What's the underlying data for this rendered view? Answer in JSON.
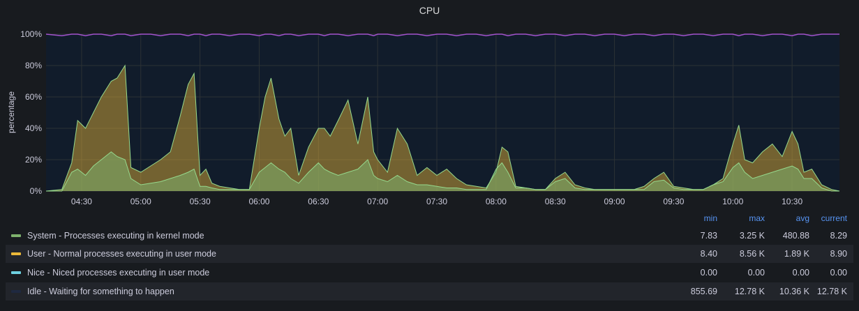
{
  "panel": {
    "title": "CPU"
  },
  "chart_data": {
    "type": "area",
    "title": "CPU",
    "ylabel": "percentage",
    "ylim": [
      0,
      100
    ],
    "y_ticks": [
      "0%",
      "20%",
      "40%",
      "60%",
      "80%",
      "100%"
    ],
    "x_ticks": [
      "04:30",
      "05:00",
      "05:30",
      "06:00",
      "06:30",
      "07:00",
      "07:30",
      "08:00",
      "08:30",
      "09:00",
      "09:30",
      "10:00",
      "10:30"
    ],
    "x_range": [
      "04:12",
      "10:54"
    ],
    "grid": true,
    "legend_placement": "bottom",
    "x": [
      "04:12",
      "04:20",
      "04:25",
      "04:28",
      "04:32",
      "04:36",
      "04:40",
      "04:45",
      "04:48",
      "04:52",
      "04:55",
      "05:00",
      "05:05",
      "05:10",
      "05:15",
      "05:20",
      "05:24",
      "05:27",
      "05:30",
      "05:33",
      "05:36",
      "05:40",
      "05:45",
      "05:50",
      "05:55",
      "06:00",
      "06:03",
      "06:06",
      "06:10",
      "06:13",
      "06:16",
      "06:20",
      "06:25",
      "06:30",
      "06:33",
      "06:36",
      "06:40",
      "06:45",
      "06:50",
      "06:55",
      "06:58",
      "07:00",
      "07:05",
      "07:10",
      "07:15",
      "07:20",
      "07:25",
      "07:30",
      "07:35",
      "07:40",
      "07:45",
      "07:50",
      "07:55",
      "08:00",
      "08:03",
      "08:06",
      "08:10",
      "08:15",
      "08:20",
      "08:25",
      "08:30",
      "08:35",
      "08:40",
      "08:45",
      "08:50",
      "08:55",
      "09:00",
      "09:05",
      "09:10",
      "09:15",
      "09:20",
      "09:25",
      "09:30",
      "09:35",
      "09:40",
      "09:45",
      "09:50",
      "09:55",
      "10:00",
      "10:03",
      "10:06",
      "10:10",
      "10:15",
      "10:20",
      "10:25",
      "10:30",
      "10:33",
      "10:36",
      "10:40",
      "10:45",
      "10:50",
      "10:54"
    ],
    "series": [
      {
        "name": "System - Processes executing in kernel mode",
        "color": "#7eb26d",
        "values": [
          0,
          0,
          12,
          14,
          10,
          16,
          20,
          25,
          22,
          20,
          8,
          4,
          5,
          6,
          8,
          10,
          12,
          14,
          3,
          3,
          2,
          1,
          1,
          1,
          1,
          12,
          15,
          18,
          14,
          12,
          8,
          5,
          12,
          18,
          14,
          12,
          10,
          12,
          14,
          20,
          10,
          8,
          6,
          10,
          6,
          4,
          4,
          3,
          2,
          2,
          1,
          1,
          1,
          14,
          18,
          12,
          2,
          2,
          1,
          1,
          6,
          8,
          2,
          1,
          1,
          1,
          1,
          1,
          1,
          1,
          6,
          7,
          2,
          1,
          1,
          1,
          4,
          6,
          15,
          18,
          12,
          8,
          10,
          12,
          14,
          16,
          14,
          8,
          8,
          2,
          0,
          0
        ]
      },
      {
        "name": "User - Normal processes executing in user mode",
        "color": "#eab839",
        "values": [
          0,
          1,
          18,
          45,
          40,
          50,
          60,
          70,
          72,
          80,
          15,
          12,
          16,
          20,
          25,
          48,
          68,
          75,
          10,
          14,
          5,
          3,
          2,
          1,
          1,
          40,
          60,
          72,
          46,
          35,
          40,
          10,
          28,
          40,
          40,
          35,
          45,
          58,
          30,
          60,
          25,
          20,
          12,
          40,
          30,
          10,
          15,
          10,
          14,
          8,
          4,
          3,
          2,
          12,
          28,
          25,
          3,
          2,
          1,
          1,
          8,
          12,
          4,
          2,
          1,
          1,
          1,
          1,
          1,
          3,
          8,
          12,
          3,
          2,
          1,
          1,
          4,
          8,
          30,
          42,
          20,
          18,
          25,
          30,
          22,
          38,
          30,
          12,
          14,
          4,
          1,
          0
        ]
      },
      {
        "name": "Nice - Niced processes executing in user mode",
        "color": "#6ed0e0",
        "values": [
          0,
          0,
          0,
          0,
          0,
          0,
          0,
          0,
          0,
          0,
          0,
          0,
          0,
          0,
          0,
          0,
          0,
          0,
          0,
          0,
          0,
          0,
          0,
          0,
          0,
          0,
          0,
          0,
          0,
          0,
          0,
          0,
          0,
          0,
          0,
          0,
          0,
          0,
          0,
          0,
          0,
          0,
          0,
          0,
          0,
          0,
          0,
          0,
          0,
          0,
          0,
          0,
          0,
          0,
          0,
          0,
          0,
          0,
          0,
          0,
          0,
          0,
          0,
          0,
          0,
          0,
          0,
          0,
          0,
          0,
          0,
          0,
          0,
          0,
          0,
          0,
          0,
          0,
          0,
          0,
          0,
          0,
          0,
          0,
          0,
          0,
          0,
          0,
          0,
          0,
          0,
          0
        ]
      },
      {
        "name": "Idle - Waiting for something to happen",
        "color": "#1f2940",
        "values": [
          100,
          99,
          100,
          100,
          99,
          100,
          100,
          99,
          100,
          100,
          99,
          100,
          100,
          99,
          100,
          100,
          99,
          100,
          100,
          99,
          100,
          100,
          99,
          100,
          100,
          99,
          100,
          100,
          99,
          100,
          100,
          99,
          100,
          100,
          99,
          100,
          100,
          99,
          100,
          100,
          99,
          100,
          100,
          99,
          100,
          100,
          99,
          100,
          100,
          99,
          100,
          100,
          99,
          100,
          100,
          99,
          100,
          100,
          99,
          100,
          100,
          99,
          100,
          100,
          99,
          100,
          100,
          99,
          100,
          100,
          99,
          100,
          100,
          99,
          100,
          100,
          99,
          100,
          100,
          99,
          100,
          100,
          99,
          100,
          100,
          99,
          100,
          100,
          99,
          100,
          100,
          100
        ]
      }
    ],
    "total_line": {
      "name": "",
      "color": "#a352cc"
    }
  },
  "legend": {
    "columns": [
      "min",
      "max",
      "avg",
      "current"
    ],
    "rows": [
      {
        "name": "System - Processes executing in kernel mode",
        "color": "#7eb26d",
        "min": "7.83",
        "max": "3.25 K",
        "avg": "480.88",
        "current": "8.29"
      },
      {
        "name": "User - Normal processes executing in user mode",
        "color": "#eab839",
        "min": "8.40",
        "max": "8.56 K",
        "avg": "1.89 K",
        "current": "8.90"
      },
      {
        "name": "Nice - Niced processes executing in user mode",
        "color": "#6ed0e0",
        "min": "0.00",
        "max": "0.00",
        "avg": "0.00",
        "current": "0.00"
      },
      {
        "name": "Idle - Waiting for something to happen",
        "color": "#1f2940",
        "min": "855.69",
        "max": "12.78 K",
        "avg": "10.36 K",
        "current": "12.78 K"
      }
    ]
  }
}
